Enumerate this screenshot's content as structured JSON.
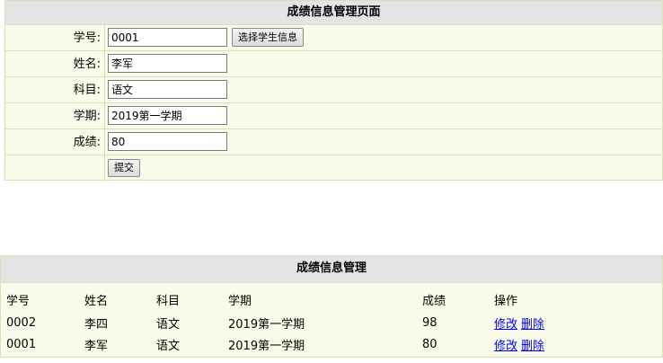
{
  "form": {
    "title": "成绩信息管理页面",
    "fields": [
      {
        "label": "学号:",
        "value": "0001"
      },
      {
        "label": "姓名:",
        "value": "李军"
      },
      {
        "label": "科目:",
        "value": "语文"
      },
      {
        "label": "学期:",
        "value": "2019第一学期"
      },
      {
        "label": "成绩:",
        "value": "80"
      }
    ],
    "select_student_label": "选择学生信息",
    "submit_label": "提交"
  },
  "list": {
    "title": "成绩信息管理",
    "columns": [
      "学号",
      "姓名",
      "科目",
      "学期",
      "成绩",
      "操作"
    ],
    "rows": [
      {
        "id": "0002",
        "name": "李四",
        "subject": "语文",
        "term": "2019第一学期",
        "score": "98",
        "edit": "修改",
        "delete": "删除"
      },
      {
        "id": "0001",
        "name": "李军",
        "subject": "语文",
        "term": "2019第一学期",
        "score": "80",
        "edit": "修改",
        "delete": "删除"
      }
    ]
  }
}
